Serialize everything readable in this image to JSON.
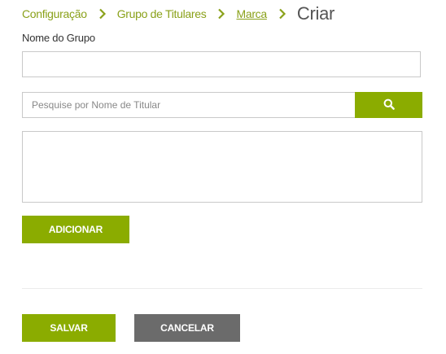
{
  "breadcrumb": {
    "items": [
      {
        "label": "Configuração"
      },
      {
        "label": "Grupo de Titulares"
      },
      {
        "label": "Marca"
      }
    ],
    "current": "Criar"
  },
  "form": {
    "group_name_label": "Nome do Grupo",
    "group_name_value": "",
    "search_placeholder": "Pesquise por Nome de Titular",
    "search_value": "",
    "add_button_label": "ADICIONAR"
  },
  "actions": {
    "save_label": "SALVAR",
    "cancel_label": "CANCELAR"
  },
  "icons": {
    "breadcrumb_separator": "chevron-right-icon",
    "search": "search-icon"
  },
  "colors": {
    "accent": "#8bac00",
    "link": "#8aa11a",
    "secondary_button": "#6b6b6b",
    "current_crumb": "#555555"
  }
}
